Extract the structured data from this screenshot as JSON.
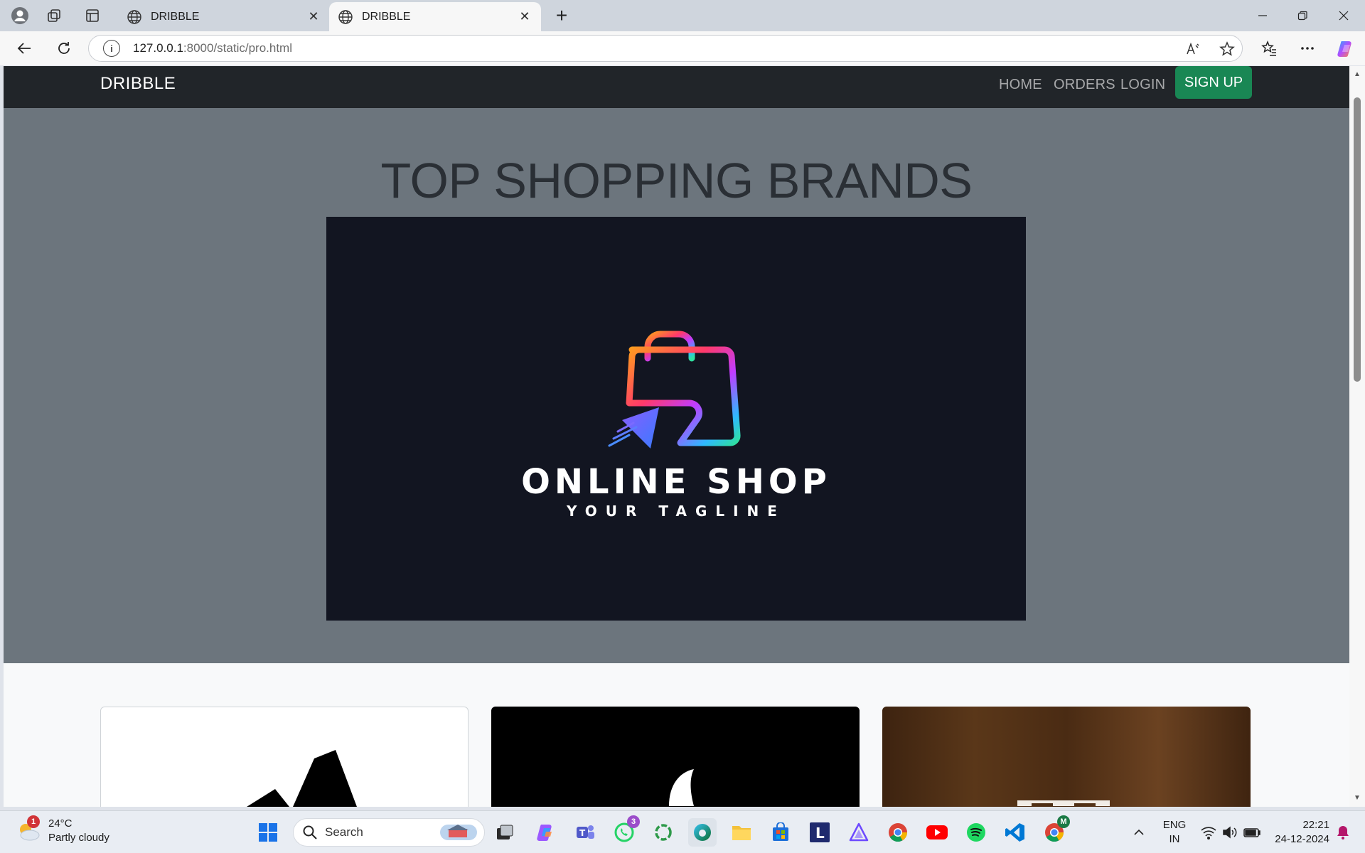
{
  "browser": {
    "tabs": [
      {
        "title": "DRIBBLE",
        "active": false
      },
      {
        "title": "DRIBBLE",
        "active": true
      }
    ],
    "url_host": "127.0.0.1",
    "url_rest": ":8000/static/pro.html"
  },
  "site": {
    "brand": "DRIBBLE",
    "nav": {
      "home": "HOME",
      "orders": "ORDERS",
      "login": "LOGIN",
      "signup": "SIGN UP"
    },
    "hero": {
      "title": "TOP SHOPPING BRANDS",
      "image": {
        "shop_name": "ONLINE SHOP",
        "tagline": "YOUR TAGLINE"
      }
    }
  },
  "colors": {
    "navbar": "#212529",
    "hero_bg": "#6c757d",
    "signup": "#198754"
  },
  "taskbar": {
    "weather": {
      "temp": "24°C",
      "condition": "Partly cloudy",
      "alert_count": "1"
    },
    "search_label": "Search",
    "whatsapp_badge": "3",
    "chrome_badge": "M",
    "lang": "ENG",
    "region": "IN",
    "time": "22:21",
    "date": "24-12-2024"
  }
}
